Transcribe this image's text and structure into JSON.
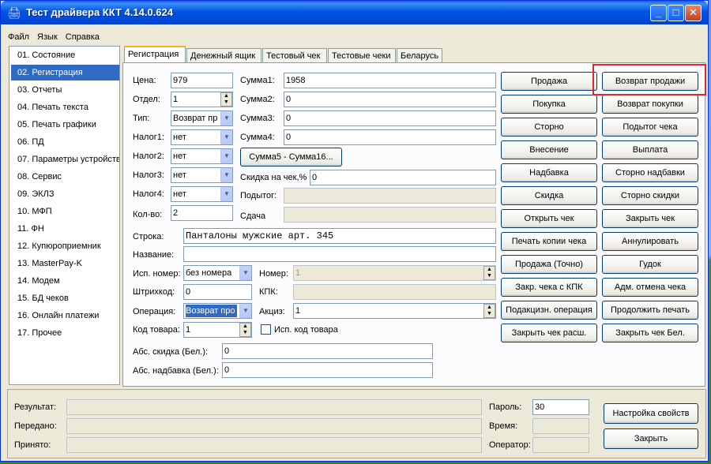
{
  "window": {
    "title": "Тест драйвера ККТ 4.14.0.624",
    "minimize": "_",
    "maximize": "□",
    "close": "✕"
  },
  "menu": [
    "Файл",
    "Язык",
    "Справка"
  ],
  "sidebar": [
    "01. Состояние",
    "02. Регистрация",
    "03. Отчеты",
    "04. Печать текста",
    "05. Печать графики",
    "06. ПД",
    "07. Параметры устройства",
    "08. Сервис",
    "09. ЭКЛЗ",
    "10. МФП",
    "11. ФН",
    "12. Купюроприемник",
    "13. MasterPay-K",
    "14. Модем",
    "15. БД чеков",
    "16. Онлайн платежи",
    "17. Прочее"
  ],
  "sidebar_selected": "02. Регистрация",
  "tabs": [
    "Регистрация",
    "Денежный ящик",
    "Тестовый чек",
    "Тестовые чеки",
    "Беларусь"
  ],
  "form": {
    "price_label": "Цена:",
    "price": "979",
    "dept_label": "Отдел:",
    "dept": "1",
    "type_label": "Тип:",
    "type": "Возврат пр",
    "tax1_label": "Налог1:",
    "tax1": "нет",
    "tax2_label": "Налог2:",
    "tax2": "нет",
    "tax3_label": "Налог3:",
    "tax3": "нет",
    "tax4_label": "Налог4:",
    "tax4": "нет",
    "qty_label": "Кол-во:",
    "qty": "2",
    "sum1_label": "Сумма1:",
    "sum1": "1958",
    "sum2_label": "Сумма2:",
    "sum2": "0",
    "sum3_label": "Сумма3:",
    "sum3": "0",
    "sum4_label": "Сумма4:",
    "sum4": "0",
    "sum516_button": "Сумма5 - Сумма16...",
    "discount_label": "Скидка на чек,%",
    "discount": "0",
    "subtotal_label": "Подытог:",
    "subtotal": "",
    "change_label": "Сдача",
    "change": "",
    "line_label": "Строка:",
    "line": "Панталоны мужские арт. 345",
    "name_label": "Название:",
    "name": "",
    "use_number_label": "Исп. номер:",
    "use_number": "без номера",
    "number_label": "Номер:",
    "number": "1",
    "barcode_label": "Штрихкод:",
    "barcode": "0",
    "kpk_label": "КПК:",
    "kpk": "",
    "operation_label": "Операция:",
    "operation": "Возврат про",
    "excise_label": "Акциз:",
    "excise": "1",
    "product_code_label": "Код товара:",
    "product_code": "1",
    "use_product_code_label": "Исп. код товара",
    "abs_discount_label": "Абс. скидка (Бел.):",
    "abs_discount": "0",
    "abs_markup_label": "Абс. надбавка (Бел.):",
    "abs_markup": "0"
  },
  "buttons_left": [
    "Продажа",
    "Покупка",
    "Сторно",
    "Внесение",
    "Надбавка",
    "Скидка",
    "Открыть чек",
    "Печать копии чека",
    "Продажа (Точно)",
    "Закр. чека с КПК",
    "Подакцизн. операция",
    "Закрыть чек расш."
  ],
  "buttons_right": [
    "Возврат продажи",
    "Возврат покупки",
    "Подытог чека",
    "Выплата",
    "Сторно надбавки",
    "Сторно скидки",
    "Закрыть чек",
    "Аннулировать",
    "Гудок",
    "Адм. отмена чека",
    "Продолжить печать",
    "Закрыть чек Бел."
  ],
  "status": {
    "result_label": "Результат:",
    "result": "",
    "sent_label": "Передано:",
    "sent": "",
    "received_label": "Принято:",
    "received": "",
    "password_label": "Пароль:",
    "password": "30",
    "time_label": "Время:",
    "time": "",
    "operator_label": "Оператор:",
    "operator": "",
    "settings_button": "Настройка свойств",
    "close_button": "Закрыть"
  },
  "colors": {
    "title_bar": "#0055e5",
    "selection": "#316ac5",
    "highlight": "#e0272b",
    "window_bg": "#ece9d8"
  }
}
